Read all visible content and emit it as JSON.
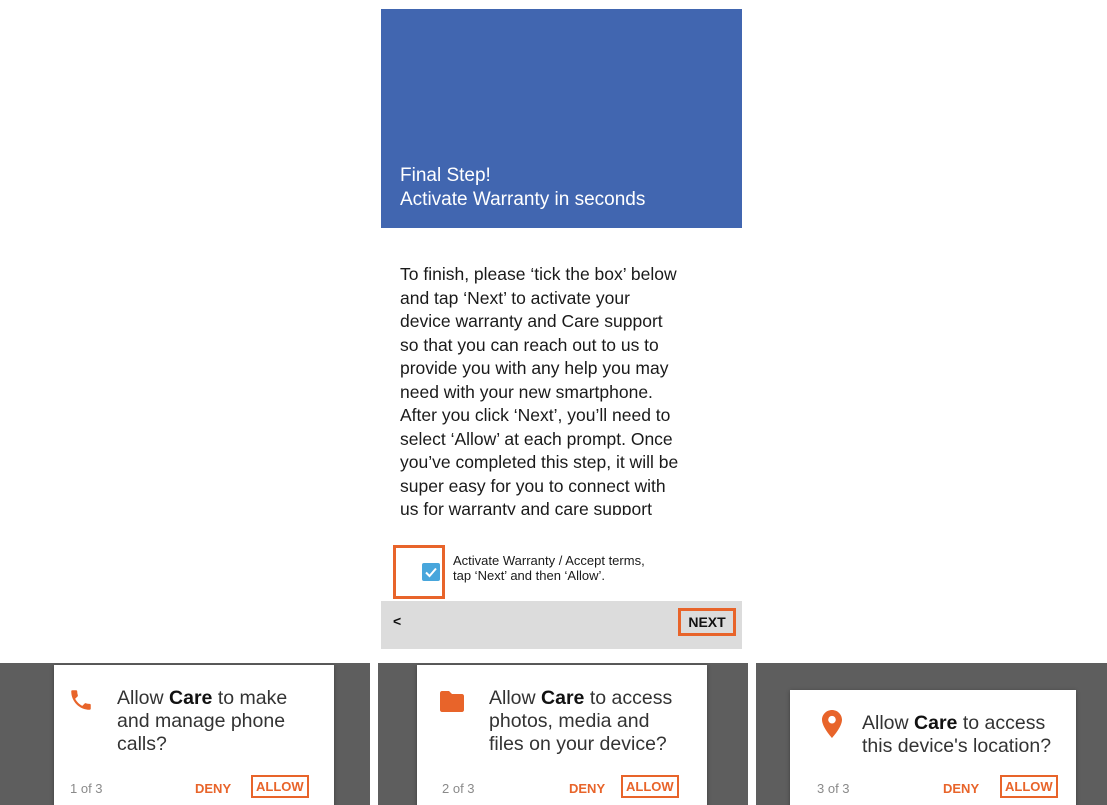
{
  "setup": {
    "hero_line1": "Final Step!",
    "hero_line2": "Activate Warranty in seconds",
    "body_lines": [
      "To finish, please ‘tick the box’ below",
      "and tap ‘Next’ to activate your",
      "device warranty and Care support",
      "so that you can reach out to us to",
      "provide you with any help you may",
      "need with your new smartphone.",
      "After you click ‘Next’, you’ll need to",
      "select ‘Allow’ at each prompt. Once",
      "you’ve completed this step, it will be",
      "super easy for you to connect with",
      "us for warranty and care support"
    ],
    "checkbox_line1": "Activate Warranty / Accept terms,",
    "checkbox_line2": "tap ‘Next’ and then ‘Allow’.",
    "checkbox_checked": true,
    "back_label": "<",
    "next_label": "NEXT"
  },
  "dialogs": [
    {
      "icon": "phone-icon",
      "line1_pre": "Allow ",
      "app": "Care",
      "line1_post": " to make",
      "line2": "and manage phone",
      "line3": "calls?",
      "count": "1 of 3",
      "deny": "DENY",
      "allow": "ALLOW"
    },
    {
      "icon": "folder-icon",
      "line1_pre": "Allow ",
      "app": "Care",
      "line1_post": " to access",
      "line2": "photos, media and",
      "line3": "files on your device?",
      "count": "2 of 3",
      "deny": "DENY",
      "allow": "ALLOW"
    },
    {
      "icon": "location-pin-icon",
      "line1_pre": "Allow ",
      "app": "Care",
      "line1_post": " to access",
      "line2": "this device's location?",
      "count": "3 of 3",
      "deny": "DENY",
      "allow": "ALLOW"
    }
  ],
  "colors": {
    "hero": "#4166b0",
    "accent": "#e8642a",
    "checkbox": "#48a6dc"
  }
}
